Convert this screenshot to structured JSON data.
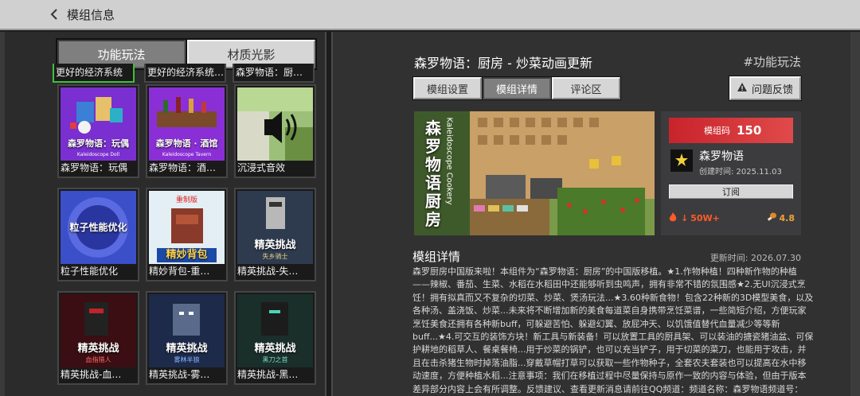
{
  "topbar": {
    "title": "模组信息"
  },
  "left_tabs": [
    {
      "label": "功能玩法",
      "active": true
    },
    {
      "label": "材质光影",
      "active": false
    }
  ],
  "top_partial_labels": [
    "更好的经济系统",
    "更好的经济系统…",
    "森罗物语：厨…"
  ],
  "cards": [
    {
      "label": "森罗物语：玩偶",
      "thumb_title": "森罗物语：玩偶",
      "thumb_sub": "Kaleidoscope Doll"
    },
    {
      "label": "森罗物语：酒…",
      "thumb_title": "森罗物语 · 酒馆",
      "thumb_sub": "Kaleidoscope Tavern"
    },
    {
      "label": "沉浸式音效",
      "thumb_title": "",
      "thumb_sub": ""
    },
    {
      "label": "粒子性能优化",
      "thumb_title": "粒子性能优化",
      "thumb_sub": ""
    },
    {
      "label": "精妙背包-重…",
      "thumb_title": "精妙背包",
      "thumb_sub": "重制版"
    },
    {
      "label": "精英挑战-失…",
      "thumb_title": "精英挑战",
      "thumb_sub": "失乡骑士"
    },
    {
      "label": "精英挑战-血…",
      "thumb_title": "精英挑战",
      "thumb_sub": "血指猎人"
    },
    {
      "label": "精英挑战-雾…",
      "thumb_title": "精英挑战",
      "thumb_sub": "雾林半狼"
    },
    {
      "label": "精英挑战-黑…",
      "thumb_title": "精英挑战",
      "thumb_sub": "黑刀之首"
    }
  ],
  "detail": {
    "title": "森罗物语：厨房 - 炒菜动画更新",
    "tag": "#功能玩法",
    "subtabs": [
      {
        "label": "模组设置",
        "active": false
      },
      {
        "label": "模组详情",
        "active": true
      },
      {
        "label": "评论区",
        "active": false
      }
    ],
    "feedback_label": "问题反馈",
    "banner_title": "森罗物语 厨房",
    "banner_sub": "Kaleidoscope Cookery",
    "code_label": "模组码",
    "code_value": "150",
    "author": "森罗物语",
    "created": "创建时间: 2025.11.03",
    "subscribe": "订阅",
    "hot": "50W+",
    "rating": "4.8",
    "section_title": "模组详情",
    "updated": "更新时间: 2026.07.30",
    "body": "森罗厨房中国版来啦！本组件为“森罗物语：厨房”的中国版移植。★1.作物种植！四种新作物的种植——辣椒、番茄、生菜、水稻在水稻田中还能够听到虫鸣声，拥有非常不错的氛围感★2.无UI沉浸式烹饪！拥有拟真而又不复杂的切菜、炒菜、煲汤玩法...★3.60种新食物！包含22种新的3D模型美食，以及各种汤、盖浇饭、炒菜...未来将不断增加新的美食每道菜自身携带烹饪菜谱，一些简短介绍，方便玩家烹饪美食还拥有各种新buff，可躲避苦怕、躲避幻翼、放屁冲天、以饥饿值替代血量减少等等新buff...★4.可交互的装饰方块！新工具与新装备！可以放置工具的厨具架、可以装油的搪瓷猪油盆、可保护耕地的稻草人、餐桌餐椅...用于炒菜的锅铲，也可以充当铲子，用于切菜的菜刀，也能用于攻击，并且在击杀猪生物时掉落油脂...穿戴草帽打草可以获取一些作物种子，全套农夫套装也可以提高在水中移动速度，方便种植水稻...注意事项：我们在移植过程中尽量保持与原作一致的内容与体验，但由于版本差异部分内容上会有所调整。反馈建议、查看更新消息请前往QQ频道：频道名称：森罗物语频道号："
  },
  "colors": {
    "accent_red": "#c8232b",
    "selected_green": "#3fbf3f",
    "hot": "#ff5a2a",
    "rating": "#f0a23a"
  }
}
